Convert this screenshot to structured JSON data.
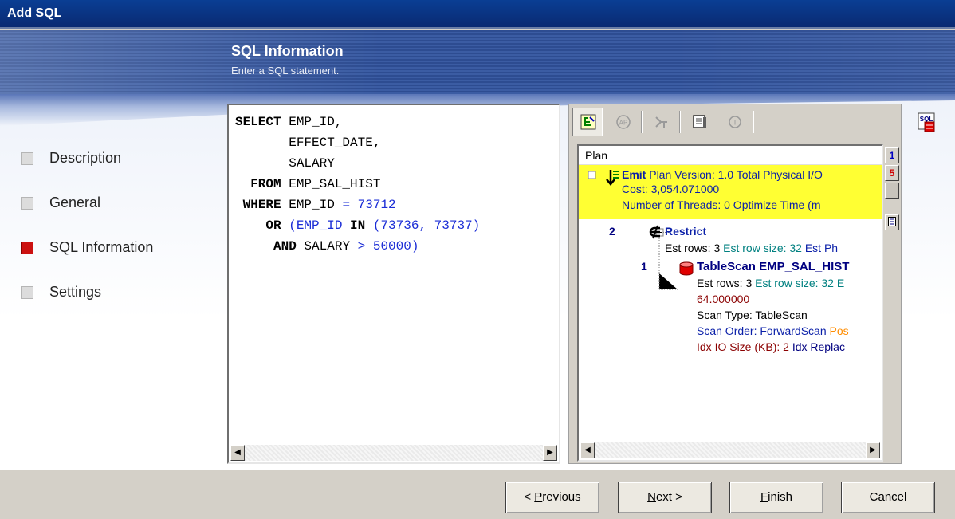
{
  "window": {
    "title": "Add SQL"
  },
  "header": {
    "title": "SQL Information",
    "subtitle": "Enter a SQL statement."
  },
  "steps": [
    {
      "label": "Description",
      "active": false
    },
    {
      "label": "General",
      "active": false
    },
    {
      "label": "SQL Information",
      "active": true
    },
    {
      "label": "Settings",
      "active": false
    }
  ],
  "sql": {
    "l1_kw": "SELECT",
    "l1_rest": " EMP_ID,",
    "l2": "EFFECT_DATE,",
    "l3": "SALARY",
    "l4_kw": "FROM",
    "l4_rest": " EMP_SAL_HIST",
    "l5_kw": "WHERE",
    "l5_rest": " EMP_ID",
    "l5_op": " = 73712",
    "l6_kw": "OR",
    "l6_a": " (EMP_ID ",
    "l6_kw2": "IN",
    "l6_b": " (73736, 73737)",
    "l7_kw": "AND",
    "l7_a": " SALARY",
    "l7_b": " > 50000)"
  },
  "plan": {
    "header": "Plan",
    "emit": {
      "name": "Emit",
      "line1": " Plan Version: 1.0  Total Physical I/O",
      "line2": "Cost: 3,054.071000",
      "line3": "Number of Threads: 0  Optimize Time (m"
    },
    "restrict": {
      "num": "2",
      "name": "Restrict",
      "est_rows": "Est rows: 3",
      "est_row_size": "  Est row size: 32",
      "est_ph": "  Est Ph"
    },
    "tablescan": {
      "num": "1",
      "name": "TableScan EMP_SAL_HIST",
      "est_rows": "Est rows: 3",
      "est_row_size": "  Est row size: 32  E",
      "cost": "64.000000",
      "scan_type": "Scan Type: TableScan",
      "scan_order": "Scan Order: ForwardScan",
      "pos": "  Pos",
      "idx_io": "Idx IO Size (KB): 2",
      "idx_replace": "  Idx Replac"
    },
    "side_buttons": [
      "1",
      "5"
    ]
  },
  "buttons": {
    "previous": {
      "pre": "< ",
      "u": "P",
      "post": "revious"
    },
    "next": {
      "pre": "",
      "u": "N",
      "post": "ext >"
    },
    "finish": {
      "pre": "",
      "u": "F",
      "post": "inish"
    },
    "cancel": "Cancel"
  },
  "colors": {
    "active_step": "#cc1111",
    "emit_highlight": "#ffff33",
    "title_bar": "#0a3e94"
  }
}
